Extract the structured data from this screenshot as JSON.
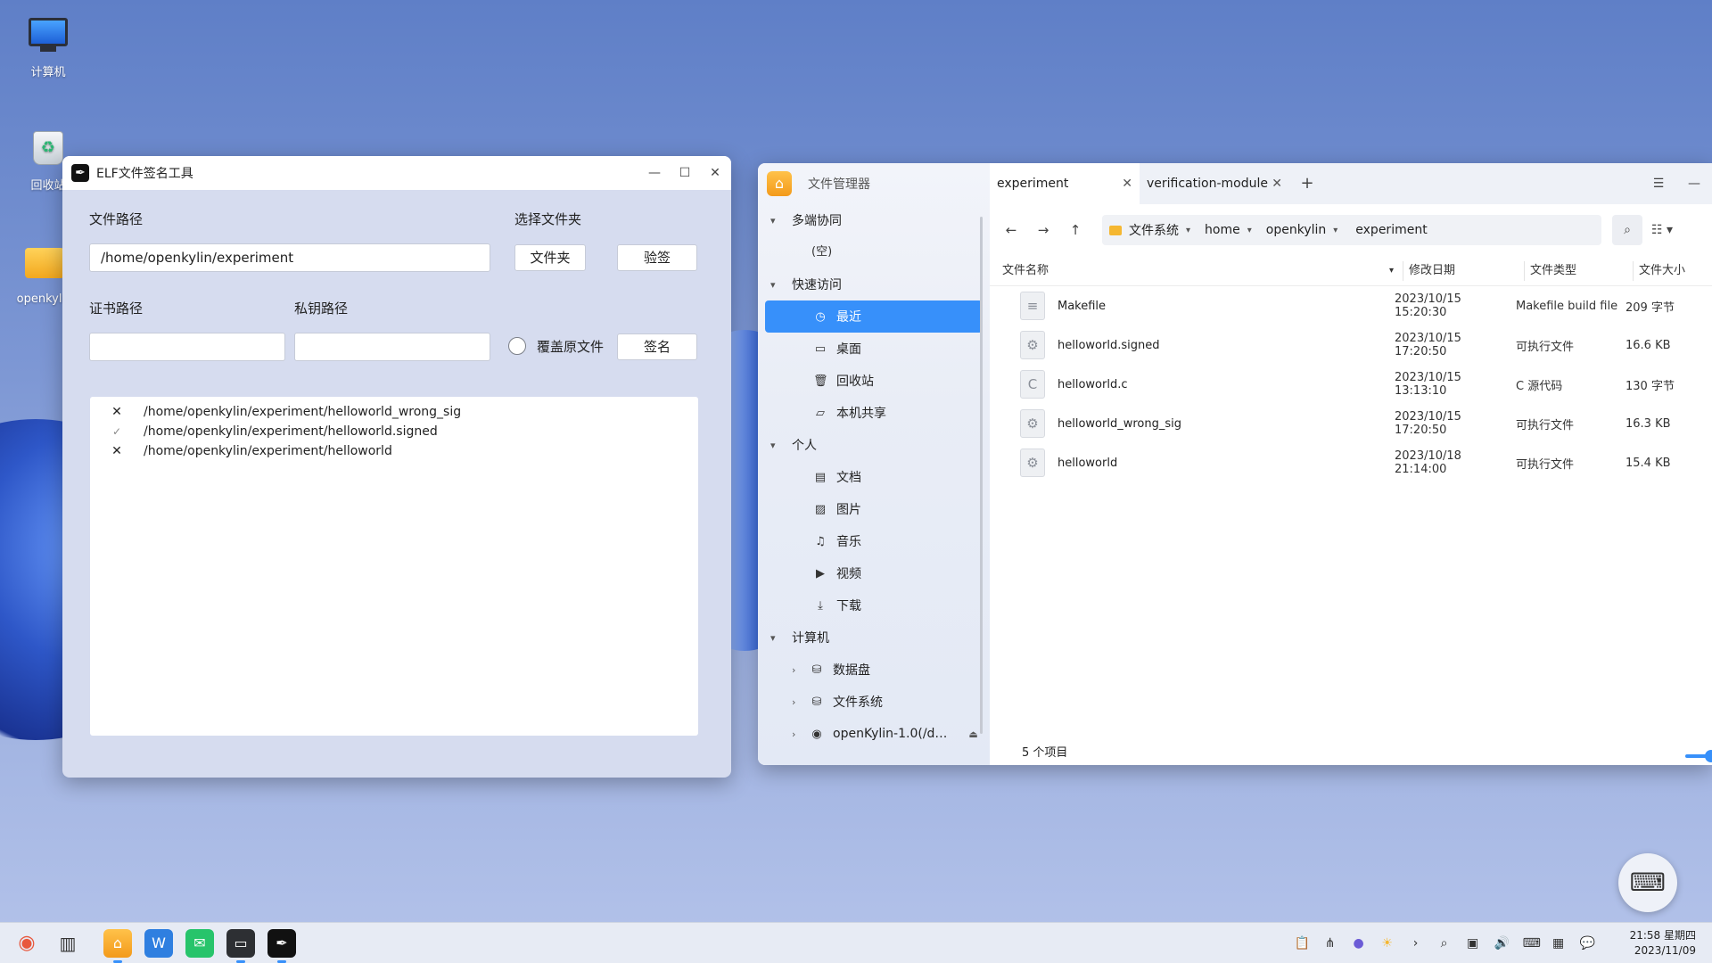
{
  "desktop": {
    "icons": [
      {
        "label": "计算机"
      },
      {
        "label": "回收站"
      },
      {
        "label": "openkylin"
      }
    ]
  },
  "elf_window": {
    "title": "ELF文件签名工具",
    "labels": {
      "file_path": "文件路径",
      "choose_folder": "选择文件夹",
      "cert_path": "证书路径",
      "key_path": "私钥路径",
      "overwrite": "覆盖原文件"
    },
    "inputs": {
      "file_path_value": "/home/openkylin/experiment",
      "cert_path_value": "",
      "key_path_value": ""
    },
    "buttons": {
      "folder": "文件夹",
      "verify": "验签",
      "sign": "签名"
    },
    "results": [
      {
        "status": "fail",
        "status_glyph": "✕",
        "path": "/home/openkylin/experiment/helloworld_wrong_sig"
      },
      {
        "status": "ok",
        "status_glyph": "✓",
        "path": "/home/openkylin/experiment/helloworld.signed"
      },
      {
        "status": "fail",
        "status_glyph": "✕",
        "path": "/home/openkylin/experiment/helloworld"
      }
    ]
  },
  "file_manager": {
    "app_title": "文件管理器",
    "sidebar": {
      "sections": [
        {
          "label": "多端协同",
          "items": [],
          "empty_text": "(空)"
        },
        {
          "label": "快速访问",
          "items": [
            {
              "label": "最近",
              "icon": "clock-icon",
              "active": true
            },
            {
              "label": "桌面",
              "icon": "desktop-icon"
            },
            {
              "label": "回收站",
              "icon": "trash-icon"
            },
            {
              "label": "本机共享",
              "icon": "folder-icon"
            }
          ]
        },
        {
          "label": "个人",
          "items": [
            {
              "label": "文档",
              "icon": "document-icon"
            },
            {
              "label": "图片",
              "icon": "image-icon"
            },
            {
              "label": "音乐",
              "icon": "music-icon"
            },
            {
              "label": "视频",
              "icon": "video-icon"
            },
            {
              "label": "下载",
              "icon": "download-icon"
            }
          ]
        },
        {
          "label": "计算机",
          "items": [
            {
              "label": "数据盘",
              "icon": "drive-icon"
            },
            {
              "label": "文件系统",
              "icon": "drive-icon"
            },
            {
              "label": "openKylin-1.0(/d…",
              "icon": "disc-icon"
            }
          ]
        }
      ]
    },
    "tabs": [
      {
        "label": "experiment",
        "active": true
      },
      {
        "label": "verification-module",
        "active": false
      }
    ],
    "breadcrumb": [
      {
        "label": "文件系统"
      },
      {
        "label": "home"
      },
      {
        "label": "openkylin"
      }
    ],
    "current_dir": "experiment",
    "columns": {
      "name": "文件名称",
      "date": "修改日期",
      "type": "文件类型",
      "size": "文件大小"
    },
    "files": [
      {
        "name": "Makefile",
        "date": "2023/10/15 15:20:30",
        "type": "Makefile build file",
        "size": "209 字节",
        "icon": "text-file-icon"
      },
      {
        "name": "helloworld.signed",
        "date": "2023/10/15 17:20:50",
        "type": "可执行文件",
        "size": "16.6 KB",
        "icon": "executable-icon"
      },
      {
        "name": "helloworld.c",
        "date": "2023/10/15 13:13:10",
        "type": "C 源代码",
        "size": "130 字节",
        "icon": "c-source-icon"
      },
      {
        "name": "helloworld_wrong_sig",
        "date": "2023/10/15 17:20:50",
        "type": "可执行文件",
        "size": "16.3 KB",
        "icon": "executable-icon"
      },
      {
        "name": "helloworld",
        "date": "2023/10/18 21:14:00",
        "type": "可执行文件",
        "size": "15.4 KB",
        "icon": "executable-icon"
      }
    ],
    "status": "5 个项目"
  },
  "taskbar": {
    "clock_time": "21:58 星期四",
    "clock_date": "2023/11/09"
  },
  "colors": {
    "accent": "#3790fa",
    "elf_bg": "#d6dcef"
  }
}
